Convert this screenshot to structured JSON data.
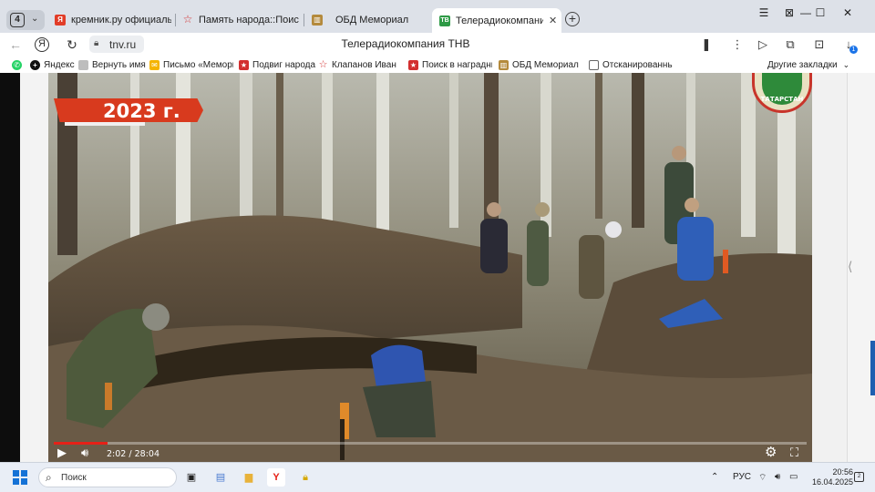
{
  "browser": {
    "tab_count": "4",
    "tabs": [
      {
        "title": "кремник.ру официальный",
        "icon": "yandex-icon",
        "color": "#e23d28"
      },
      {
        "title": "Память народа::Поиск до",
        "icon": "red-star-icon",
        "color": "#d32f2f"
      },
      {
        "title": "ОБД Мемориал",
        "icon": "memorial-icon",
        "color": "#b48a3c"
      },
      {
        "title": "Телерадиокомпания ТНВ",
        "icon": "tnv-icon",
        "color": "#2e9a46"
      }
    ],
    "address": {
      "host": "tnv.ru",
      "page_title": "Телерадиокомпания ТНВ"
    },
    "download_badge": "1",
    "bookmarks": [
      {
        "label": "",
        "icon": "whatsapp-icon",
        "color": "#25d366"
      },
      {
        "label": "Яндекс",
        "icon": "yandex-plus-icon",
        "color": "#111111"
      },
      {
        "label": "Вернуть имя",
        "icon": "page-icon",
        "color": "#9e9e9e"
      },
      {
        "label": "Письмо «Мемори",
        "icon": "mail-icon",
        "color": "#f5b400"
      },
      {
        "label": "Подвиг народа",
        "icon": "podvig-icon",
        "color": "#d32f2f"
      },
      {
        "label": "Клапанов Иван С",
        "icon": "red-star-icon",
        "color": "#d32f2f"
      },
      {
        "label": "Поиск в наградны",
        "icon": "podvig-icon",
        "color": "#d32f2f"
      },
      {
        "label": "ОБД Мемориал :",
        "icon": "memorial-icon",
        "color": "#b48a3c"
      },
      {
        "label": "Отсканированны",
        "icon": "document-icon",
        "color": "#666666"
      }
    ],
    "other_bookmarks": "Другие закладки"
  },
  "video": {
    "year_badge": "2023 г.",
    "logo_text": "ТАТАРСТАН",
    "current_time": "2:02",
    "duration": "28:04",
    "progress": 0.072
  },
  "taskbar": {
    "search_placeholder": "Поиск",
    "language": "РУС",
    "time": "20:56",
    "date": "16.04.2025"
  }
}
